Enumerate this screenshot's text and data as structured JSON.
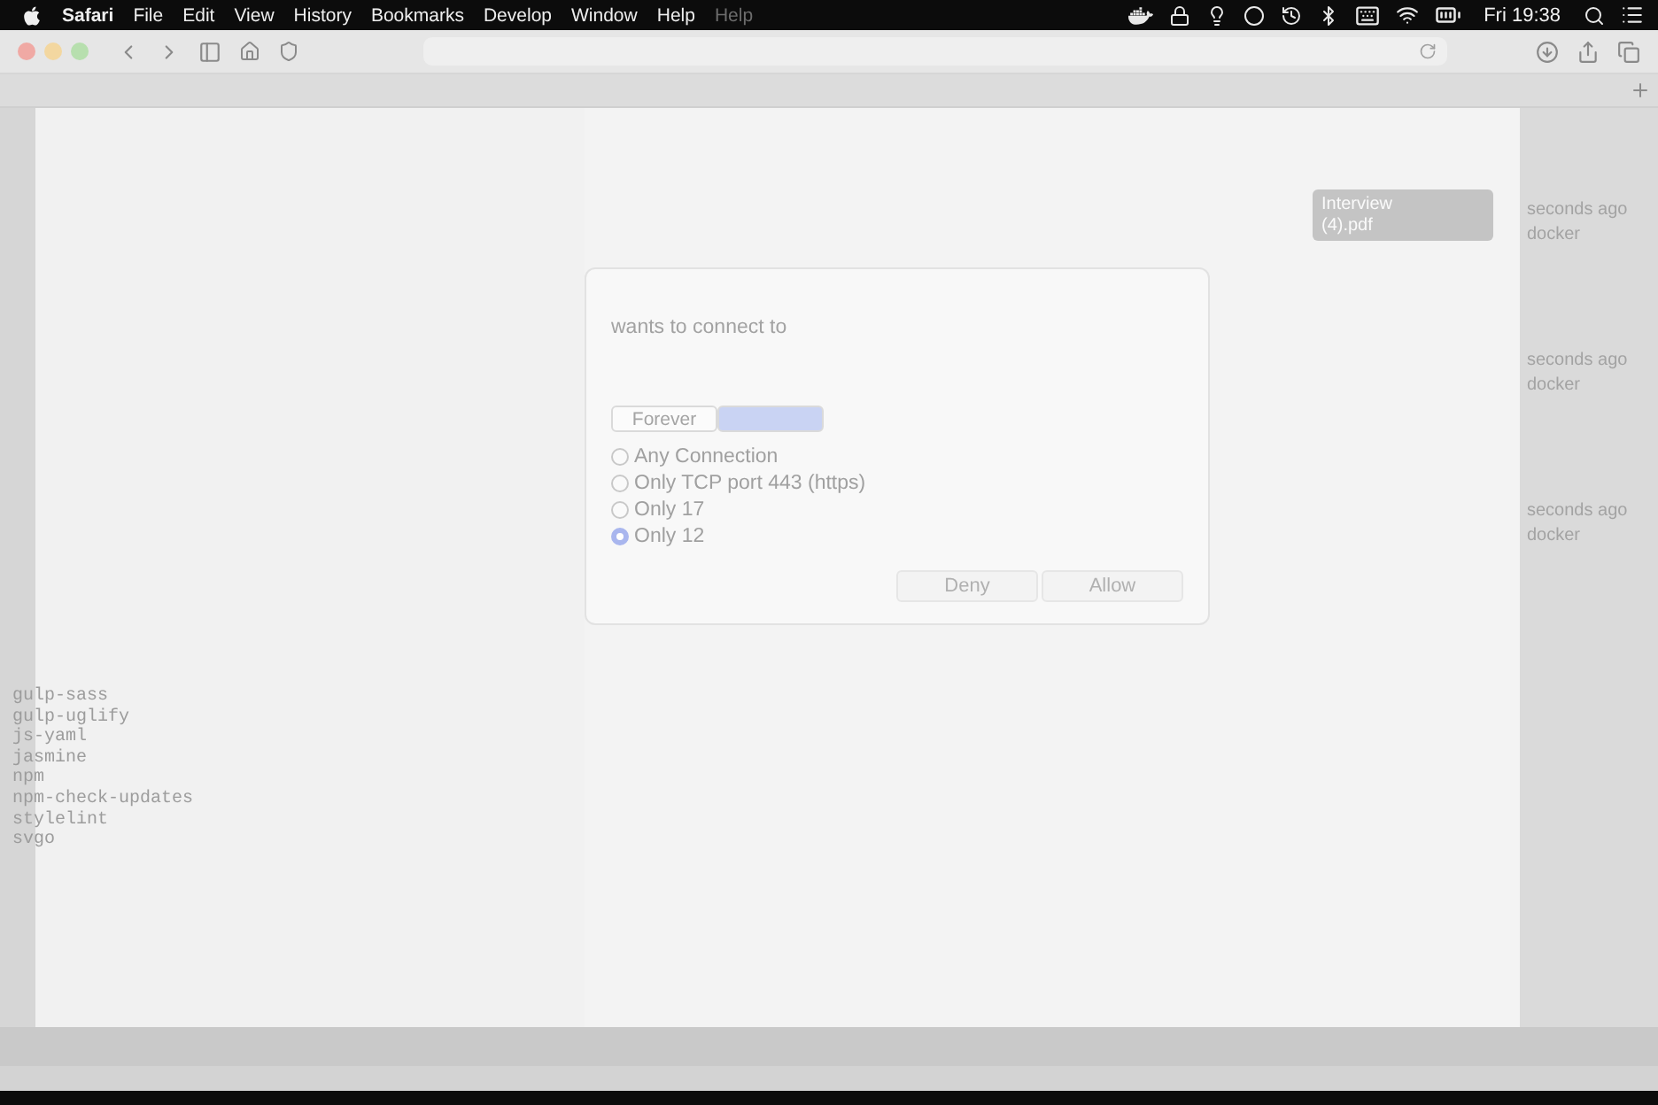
{
  "menu_bar": {
    "app": "Safari",
    "items": [
      "File",
      "Edit",
      "View",
      "History",
      "Bookmarks",
      "Develop",
      "Window",
      "Help"
    ],
    "ghost_item": "Help",
    "clock": "Fri 19:38"
  },
  "terminal": {
    "packages": [
      "gulp-sass",
      "gulp-uglify",
      "js-yaml",
      "jasmine",
      "npm",
      "npm-check-updates",
      "stylelint",
      "svgo"
    ]
  },
  "dialog": {
    "message": "wants to connect to",
    "duration": [
      {
        "label": "Forever",
        "selected": false
      },
      {
        "selected": true
      }
    ],
    "options": [
      {
        "label": "Any Connection",
        "selected": false
      },
      {
        "label": "Only TCP port 443 (https)",
        "selected": false
      },
      {
        "label": "Only 17",
        "selected": false
      },
      {
        "label": "Only 12",
        "selected": true
      }
    ],
    "buttons": [
      "Deny",
      "Allow"
    ]
  },
  "file": {
    "name": "Interview",
    "extension": "(4).pdf"
  },
  "feed": [
    {
      "time": "seconds ago",
      "source": "docker"
    },
    {
      "time": "seconds ago",
      "source": "docker"
    },
    {
      "time": "seconds ago",
      "source": "docker"
    }
  ]
}
